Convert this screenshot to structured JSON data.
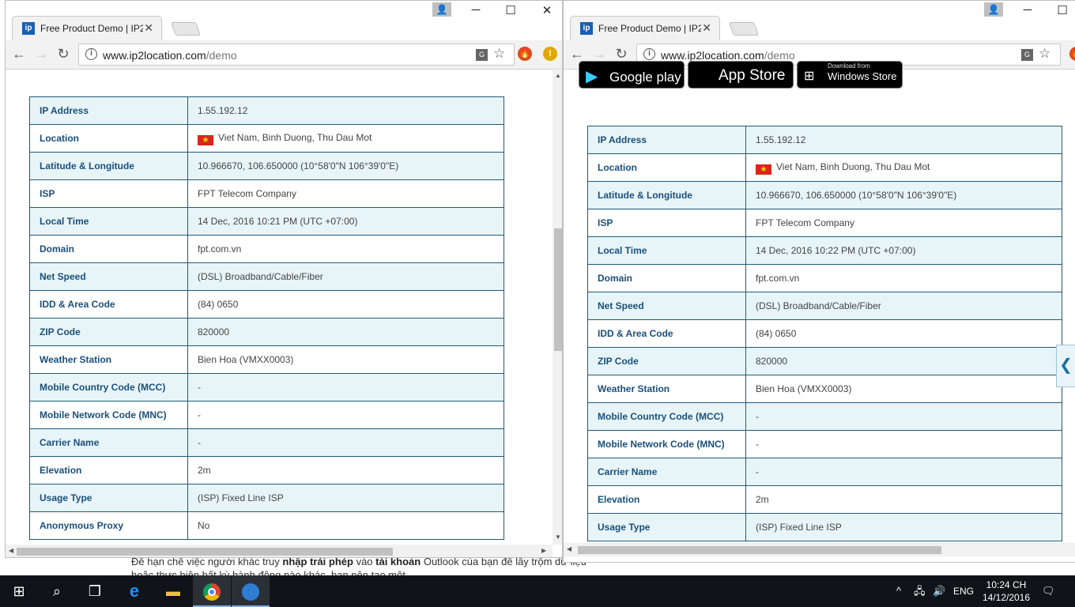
{
  "background_page": {
    "line1_parts": [
      "Để hạn chế việc người khác truy ",
      "nhập trái phép",
      " vào ",
      "tài khoản",
      " Outlook của bạn để lấy trộm dữ liệu"
    ],
    "line2": "hoặc thực hiện bất kỳ hành động nào khác, bạn nên tạo một"
  },
  "window_left": {
    "tab_title": "Free Product Demo | IP2L",
    "tab_favicon": "ip",
    "url_host": "www.ip2location.com",
    "url_path": "/demo",
    "rows": [
      {
        "key": "IP Address",
        "value": "1.55.192.12"
      },
      {
        "key": "Location",
        "value": "Viet Nam, Binh Duong, Thu Dau Mot",
        "flag": true
      },
      {
        "key": "Latitude & Longitude",
        "value": "10.966670, 106.650000 (10°58'0\"N   106°39'0\"E)"
      },
      {
        "key": "ISP",
        "value": "FPT Telecom Company"
      },
      {
        "key": "Local Time",
        "value": "14 Dec, 2016 10:21 PM (UTC +07:00)"
      },
      {
        "key": "Domain",
        "value": "fpt.com.vn"
      },
      {
        "key": "Net Speed",
        "value": "(DSL) Broadband/Cable/Fiber"
      },
      {
        "key": "IDD & Area Code",
        "value": "(84) 0650"
      },
      {
        "key": "ZIP Code",
        "value": "820000"
      },
      {
        "key": "Weather Station",
        "value": "Bien Hoa (VMXX0003)"
      },
      {
        "key": "Mobile Country Code (MCC)",
        "value": "-"
      },
      {
        "key": "Mobile Network Code (MNC)",
        "value": "-"
      },
      {
        "key": "Carrier Name",
        "value": "-"
      },
      {
        "key": "Elevation",
        "value": "2m"
      },
      {
        "key": "Usage Type",
        "value": "(ISP) Fixed Line ISP"
      },
      {
        "key": "Anonymous Proxy",
        "value": "No"
      }
    ]
  },
  "window_right": {
    "tab_title": "Free Product Demo | IP2L",
    "tab_favicon": "ip",
    "url_host": "www.ip2location.com",
    "url_path": "/demo",
    "badges": [
      {
        "small": "",
        "big": "Google play",
        "icon": "play-store-icon"
      },
      {
        "small": "",
        "big": "App Store",
        "icon": "apple-icon"
      },
      {
        "small": "Download from",
        "big": "Windows Store",
        "icon": "windows-icon"
      }
    ],
    "rows": [
      {
        "key": "IP Address",
        "value": "1.55.192.12"
      },
      {
        "key": "Location",
        "value": "Viet Nam, Binh Duong, Thu Dau Mot",
        "flag": true
      },
      {
        "key": "Latitude & Longitude",
        "value": "10.966670, 106.650000 (10°58'0\"N   106°39'0\"E)"
      },
      {
        "key": "ISP",
        "value": "FPT Telecom Company"
      },
      {
        "key": "Local Time",
        "value": "14 Dec, 2016 10:22 PM (UTC +07:00)"
      },
      {
        "key": "Domain",
        "value": "fpt.com.vn"
      },
      {
        "key": "Net Speed",
        "value": "(DSL) Broadband/Cable/Fiber"
      },
      {
        "key": "IDD & Area Code",
        "value": "(84) 0650"
      },
      {
        "key": "ZIP Code",
        "value": "820000"
      },
      {
        "key": "Weather Station",
        "value": "Bien Hoa (VMXX0003)"
      },
      {
        "key": "Mobile Country Code (MCC)",
        "value": "-"
      },
      {
        "key": "Mobile Network Code (MNC)",
        "value": "-"
      },
      {
        "key": "Carrier Name",
        "value": "-"
      },
      {
        "key": "Elevation",
        "value": "2m"
      },
      {
        "key": "Usage Type",
        "value": "(ISP) Fixed Line ISP"
      }
    ]
  },
  "taskbar": {
    "language": "ENG",
    "time": "10:24 CH",
    "date": "14/12/2016",
    "apps": [
      "start-icon",
      "search-icon",
      "task-view-icon",
      "edge-icon",
      "file-explorer-icon",
      "chrome-icon",
      "remote-app-icon"
    ]
  },
  "colors": {
    "table_border": "#1f5a7a",
    "key_text": "#1a4f7a",
    "row_shade": "#e8f5f8",
    "taskbar": "#101418"
  }
}
